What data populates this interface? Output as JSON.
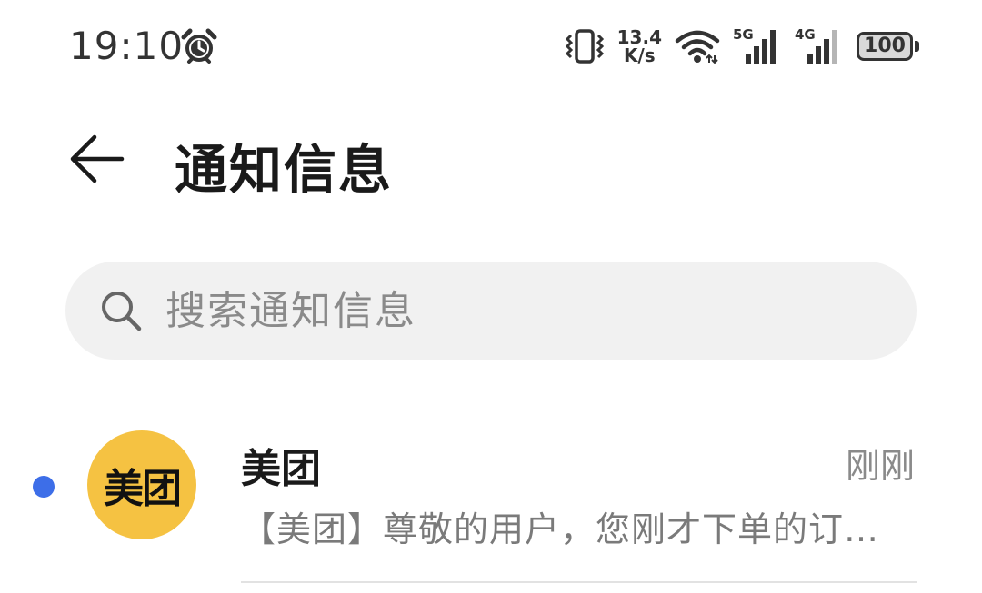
{
  "status_bar": {
    "time": "19:10",
    "net_speed_value": "13.4",
    "net_speed_unit": "K/s",
    "signal_1_label": "5G",
    "signal_2_label": "4G",
    "battery_level": "100",
    "icons": [
      "alarm-icon",
      "vibrate-icon",
      "wifi-icon",
      "signal-5g-icon",
      "signal-4g-icon",
      "battery-icon"
    ]
  },
  "header": {
    "title": "通知信息",
    "back_icon": "back-arrow-icon"
  },
  "search": {
    "placeholder": "搜索通知信息",
    "value": ""
  },
  "notifications": [
    {
      "avatar_text": "美团",
      "sender": "美团",
      "time": "刚刚",
      "preview": "【美团】尊敬的用户，您刚才下单的订…",
      "unread": true
    }
  ],
  "colors": {
    "accent_dot": "#3d6ee8",
    "avatar_bg": "#f5c242",
    "search_bg": "#f1f1f1",
    "secondary_text": "#8a8a8a"
  }
}
